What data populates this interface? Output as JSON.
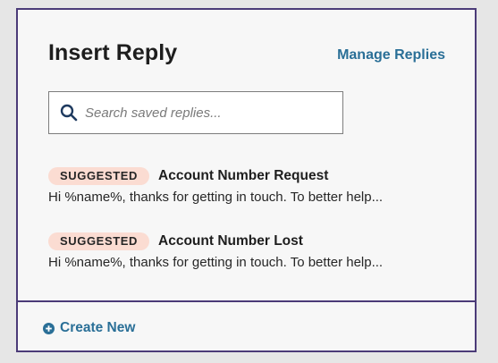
{
  "header": {
    "title": "Insert Reply",
    "manage_label": "Manage Replies"
  },
  "search": {
    "placeholder": "Search saved replies...",
    "value": ""
  },
  "replies": [
    {
      "badge": "SUGGESTED",
      "title": "Account Number Request",
      "preview": "Hi %name%, thanks for getting in touch. To better help..."
    },
    {
      "badge": "SUGGESTED",
      "title": "Account Number Lost",
      "preview": "Hi %name%, thanks for getting in touch. To better help..."
    }
  ],
  "footer": {
    "create_label": "Create New"
  },
  "colors": {
    "border": "#4b3b78",
    "link": "#2a6f97",
    "badge_bg": "#fbdcd2",
    "panel_bg": "#f7f7f7"
  },
  "icons": {
    "search": "search-icon",
    "create": "plus-circle-icon"
  }
}
